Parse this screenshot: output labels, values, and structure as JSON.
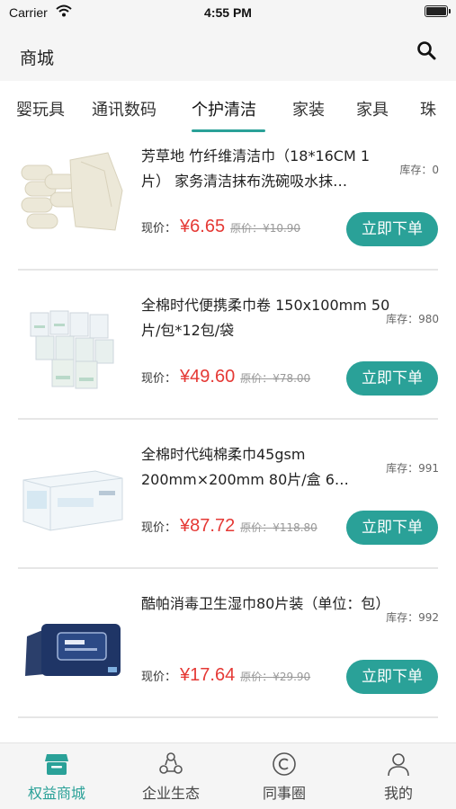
{
  "status_bar": {
    "carrier": "Carrier",
    "time": "4:55 PM"
  },
  "nav": {
    "title": "商城",
    "search_icon": "search-icon"
  },
  "categories": {
    "tabs": [
      {
        "label": "婴玩具"
      },
      {
        "label": "通讯数码"
      },
      {
        "label": "个护清洁",
        "active": true
      },
      {
        "label": "家装"
      },
      {
        "label": "家具"
      },
      {
        "label": "珠"
      }
    ]
  },
  "products": [
    {
      "name": "芳草地 竹纤维清洁巾（18*16CM 1片） 家务清洁抹布洗碗吸水抹…",
      "stock": "库存：0",
      "price_label": "现价：",
      "price": "¥6.65",
      "original_price": "原价：¥10.90",
      "buy_label": "立即下单"
    },
    {
      "name": "全棉时代便携柔巾卷 150x100mm 50片/包*12包/袋",
      "stock": "库存：980",
      "price_label": "现价：",
      "price": "¥49.60",
      "original_price": "原价：¥78.00",
      "buy_label": "立即下单"
    },
    {
      "name": "全棉时代纯棉柔巾45gsm 200mm×200mm 80片/盒 6…",
      "stock": "库存：991",
      "price_label": "现价：",
      "price": "¥87.72",
      "original_price": "原价：¥118.80",
      "buy_label": "立即下单"
    },
    {
      "name": "酷帕消毒卫生湿巾80片装（单位：包）",
      "stock": "库存：992",
      "price_label": "现价：",
      "price": "¥17.64",
      "original_price": "原价：¥29.90",
      "buy_label": "立即下单"
    }
  ],
  "tabbar": {
    "items": [
      {
        "label": "权益商城",
        "icon": "store-icon",
        "active": true
      },
      {
        "label": "企业生态",
        "icon": "ecosystem-icon"
      },
      {
        "label": "同事圈",
        "icon": "colleague-circle-icon"
      },
      {
        "label": "我的",
        "icon": "profile-icon"
      }
    ]
  },
  "colors": {
    "accent": "#2aa198",
    "price": "#e53935",
    "background": "#f5f5f5"
  }
}
